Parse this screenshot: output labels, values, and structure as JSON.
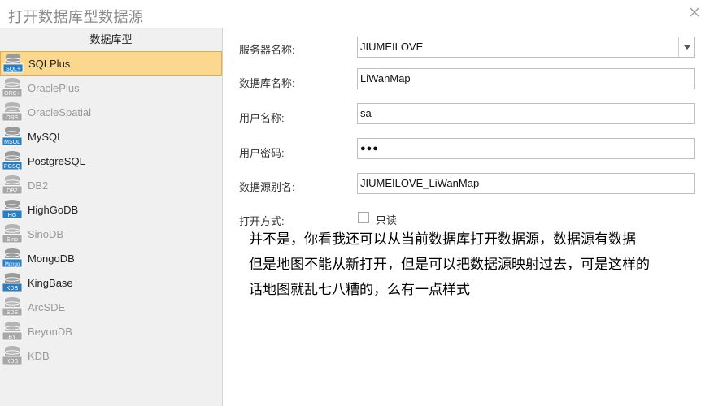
{
  "window": {
    "title": "打开数据库型数据源"
  },
  "sidebar": {
    "header": "数据库型",
    "items": [
      {
        "label": "SQLPlus",
        "icon": "SQL+",
        "selected": true,
        "enabled": true
      },
      {
        "label": "OraclePlus",
        "icon": "ORC+",
        "selected": false,
        "enabled": false
      },
      {
        "label": "OracleSpatial",
        "icon": "ORS",
        "selected": false,
        "enabled": false
      },
      {
        "label": "MySQL",
        "icon": "MSQL",
        "selected": false,
        "enabled": true
      },
      {
        "label": "PostgreSQL",
        "icon": "PGSQ",
        "selected": false,
        "enabled": true
      },
      {
        "label": "DB2",
        "icon": "DB2",
        "selected": false,
        "enabled": false
      },
      {
        "label": "HighGoDB",
        "icon": "HG",
        "selected": false,
        "enabled": true
      },
      {
        "label": "SinoDB",
        "icon": "Sino",
        "selected": false,
        "enabled": false
      },
      {
        "label": "MongoDB",
        "icon": "Mongo",
        "selected": false,
        "enabled": true
      },
      {
        "label": "KingBase",
        "icon": "KDB",
        "selected": false,
        "enabled": true
      },
      {
        "label": "ArcSDE",
        "icon": "SDE",
        "selected": false,
        "enabled": false
      },
      {
        "label": "BeyonDB",
        "icon": "BY",
        "selected": false,
        "enabled": false
      },
      {
        "label": "KDB",
        "icon": "KDB",
        "selected": false,
        "enabled": false
      }
    ]
  },
  "form": {
    "server": {
      "label": "服务器名称:",
      "value": "JIUMEILOVE"
    },
    "database": {
      "label": "数据库名称:",
      "value": "LiWanMap"
    },
    "user": {
      "label": "用户名称:",
      "value": "sa"
    },
    "password": {
      "label": "用户密码:",
      "value": "●●●"
    },
    "alias": {
      "label": "数据源别名:",
      "value": "JIUMEILOVE_LiWanMap"
    },
    "open_mode": {
      "label": "打开方式:",
      "readonly_label": "只读",
      "readonly_checked": false
    }
  },
  "comment": {
    "lines": [
      "并不是，你看我还可以从当前数据库打开数据源，数据源有数据",
      "但是地图不能从新打开，但是可以把数据源映射过去，可是这样的",
      "话地图就乱七八糟的，么有一点样式"
    ]
  },
  "colors": {
    "selected_bg": "#fbd88e",
    "selected_border": "#e4ad44",
    "enabled_icon_top": "#888888",
    "enabled_icon_label": "#2a7fc4",
    "disabled_icon": "#a8a8a8"
  }
}
